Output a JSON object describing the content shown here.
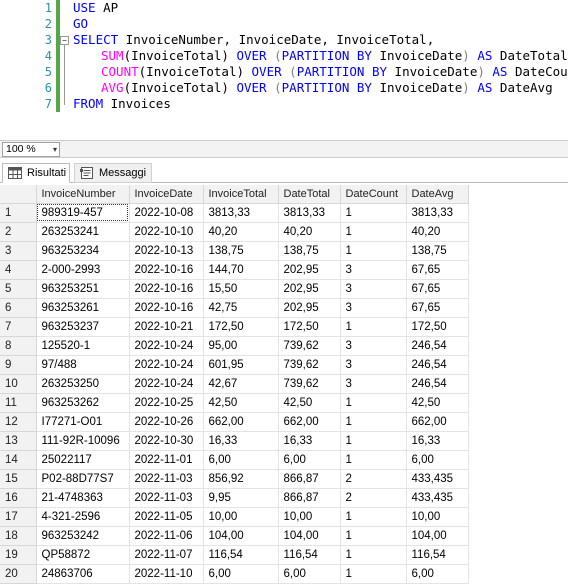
{
  "editor": {
    "line_numbers": [
      "1",
      "2",
      "3",
      "4",
      "5",
      "6",
      "7"
    ],
    "line1": {
      "kw": "USE",
      "rest": " AP"
    },
    "line2": {
      "kw": "GO"
    },
    "line3": {
      "kw": "SELECT",
      "rest": " InvoiceNumber, InvoiceDate, InvoiceTotal,"
    },
    "line4": {
      "fn": "SUM",
      "p1": "(InvoiceTotal) ",
      "over": "OVER",
      "sp": " ",
      "lp": "(",
      "part": "PARTITION",
      "by_sp": " ",
      "by": "BY",
      "col": " InvoiceDate",
      "rp": ")",
      "as_sp": " ",
      "as": "AS",
      "alias": " DateTotal,"
    },
    "line5": {
      "fn": "COUNT",
      "p1": "(InvoiceTotal) ",
      "over": "OVER",
      "sp": " ",
      "lp": "(",
      "part": "PARTITION",
      "by_sp": " ",
      "by": "BY",
      "col": " InvoiceDate",
      "rp": ")",
      "as_sp": " ",
      "as": "AS",
      "alias": " DateCount,"
    },
    "line6": {
      "fn": "AVG",
      "p1": "(InvoiceTotal) ",
      "over": "OVER",
      "sp": " ",
      "lp": "(",
      "part": "PARTITION",
      "by_sp": " ",
      "by": "BY",
      "col": " InvoiceDate",
      "rp": ")",
      "as_sp": " ",
      "as": "AS",
      "alias": " DateAvg"
    },
    "line7": {
      "kw": "FROM",
      "rest": " Invoices"
    },
    "fold_symbol": "−"
  },
  "zoom": {
    "value": "100 %",
    "arrow": "▾"
  },
  "tabs": {
    "results": "Risultati",
    "messages": "Messaggi"
  },
  "grid": {
    "columns": [
      "InvoiceNumber",
      "InvoiceDate",
      "InvoiceTotal",
      "DateTotal",
      "DateCount",
      "DateAvg"
    ],
    "rows": [
      [
        "1",
        "989319-457",
        "2022-10-08",
        "3813,33",
        "3813,33",
        "1",
        "3813,33"
      ],
      [
        "2",
        "263253241",
        "2022-10-10",
        "40,20",
        "40,20",
        "1",
        "40,20"
      ],
      [
        "3",
        "963253234",
        "2022-10-13",
        "138,75",
        "138,75",
        "1",
        "138,75"
      ],
      [
        "4",
        "2-000-2993",
        "2022-10-16",
        "144,70",
        "202,95",
        "3",
        "67,65"
      ],
      [
        "5",
        "963253251",
        "2022-10-16",
        "15,50",
        "202,95",
        "3",
        "67,65"
      ],
      [
        "6",
        "963253261",
        "2022-10-16",
        "42,75",
        "202,95",
        "3",
        "67,65"
      ],
      [
        "7",
        "963253237",
        "2022-10-21",
        "172,50",
        "172,50",
        "1",
        "172,50"
      ],
      [
        "8",
        "125520-1",
        "2022-10-24",
        "95,00",
        "739,62",
        "3",
        "246,54"
      ],
      [
        "9",
        "97/488",
        "2022-10-24",
        "601,95",
        "739,62",
        "3",
        "246,54"
      ],
      [
        "10",
        "263253250",
        "2022-10-24",
        "42,67",
        "739,62",
        "3",
        "246,54"
      ],
      [
        "11",
        "963253262",
        "2022-10-25",
        "42,50",
        "42,50",
        "1",
        "42,50"
      ],
      [
        "12",
        "I77271-O01",
        "2022-10-26",
        "662,00",
        "662,00",
        "1",
        "662,00"
      ],
      [
        "13",
        "111-92R-10096",
        "2022-10-30",
        "16,33",
        "16,33",
        "1",
        "16,33"
      ],
      [
        "14",
        "25022117",
        "2022-11-01",
        "6,00",
        "6,00",
        "1",
        "6,00"
      ],
      [
        "15",
        "P02-88D77S7",
        "2022-11-03",
        "856,92",
        "866,87",
        "2",
        "433,435"
      ],
      [
        "16",
        "21-4748363",
        "2022-11-03",
        "9,95",
        "866,87",
        "2",
        "433,435"
      ],
      [
        "17",
        "4-321-2596",
        "2022-11-05",
        "10,00",
        "10,00",
        "1",
        "10,00"
      ],
      [
        "18",
        "963253242",
        "2022-11-06",
        "104,00",
        "104,00",
        "1",
        "104,00"
      ],
      [
        "19",
        "QP58872",
        "2022-11-07",
        "116,54",
        "116,54",
        "1",
        "116,54"
      ],
      [
        "20",
        "24863706",
        "2022-11-10",
        "6,00",
        "6,00",
        "1",
        "6,00"
      ]
    ]
  }
}
